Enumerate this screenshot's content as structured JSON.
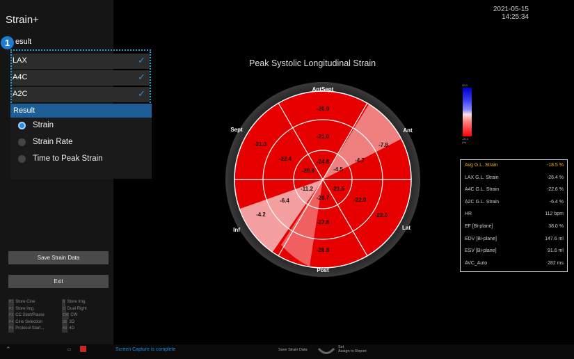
{
  "app": {
    "title": "Strain+"
  },
  "left_panel": {
    "badge": "1",
    "result_section_label": "esult",
    "views": [
      {
        "label": "LAX",
        "checked": true
      },
      {
        "label": "A4C",
        "checked": true
      },
      {
        "label": "A2C",
        "checked": true
      }
    ],
    "result_header": "Result",
    "options": [
      {
        "label": "Strain",
        "selected": true
      },
      {
        "label": "Strain Rate",
        "selected": false
      },
      {
        "label": "Time to Peak Strain",
        "selected": false
      }
    ],
    "save_button": "Save Strain Data",
    "exit_button": "Exit",
    "shortcuts": [
      {
        "key": "P1",
        "label": "Store Cine"
      },
      {
        "key": "P2",
        "label": "Store Img."
      },
      {
        "key": "P3",
        "label": "CC Start/Pause"
      },
      {
        "key": "P4",
        "label": "Cine Selection"
      },
      {
        "key": "P5",
        "label": "Protocol Start..."
      },
      {
        "key": "S",
        "label": "Store Img."
      },
      {
        "key": "D",
        "label": "Dual Right"
      },
      {
        "key": "CW",
        "label": "CW"
      },
      {
        "key": "3D",
        "label": "3D"
      },
      {
        "key": "4D",
        "label": "4D"
      }
    ]
  },
  "header": {
    "date": "2021-05-15",
    "time": "14:25:34"
  },
  "bullseye": {
    "title": "Peak Systolic Longitudinal Strain",
    "labels": {
      "top": "AntSept",
      "top_right": "Ant",
      "right": "Lat",
      "bottom": "Post",
      "left": "Inf",
      "top_left": "Sept"
    },
    "values": [
      "-20.9",
      "-21.0",
      "-7.8",
      "-22.0",
      "-26.8",
      "-4.2",
      "-21.0",
      "-22.4",
      "-24.8",
      "-4.7",
      "-22.0",
      "-27.8",
      "-6.4",
      "-28.6",
      "-4.5",
      "-11.2",
      "-21.5",
      "-28.7"
    ]
  },
  "scale": {
    "max": "20.0",
    "min": "-20.0",
    "unit": "(%)"
  },
  "metrics": [
    {
      "name": "Avg G.L. Strain",
      "value": "-18.5 %",
      "highlight": true
    },
    {
      "name": "LAX G.L. Strain",
      "value": "-26.4 %"
    },
    {
      "name": "A4C G.L. Strain",
      "value": "-22.6 %"
    },
    {
      "name": "A2C G.L. Strain",
      "value": "-6.4 %"
    },
    {
      "name": "HR",
      "value": "112 bpm"
    },
    {
      "name": "EF [Bi-plane]",
      "value": "38.0 %"
    },
    {
      "name": "EDV [Bi-plane]",
      "value": "147.6 ml"
    },
    {
      "name": "ESV [Bi-plane]",
      "value": "91.6 ml"
    },
    {
      "name": "AVC_Auto",
      "value": "282 ms"
    }
  ],
  "bottom": {
    "status": "Screen Capture is complete",
    "save_label": "Save Strain Data",
    "set_label": "Set",
    "assign_label": "Assign to Report"
  },
  "colors": {
    "accent": "#1d7bd0",
    "segment_red": "#e60000",
    "highlight": "#f2b400"
  }
}
